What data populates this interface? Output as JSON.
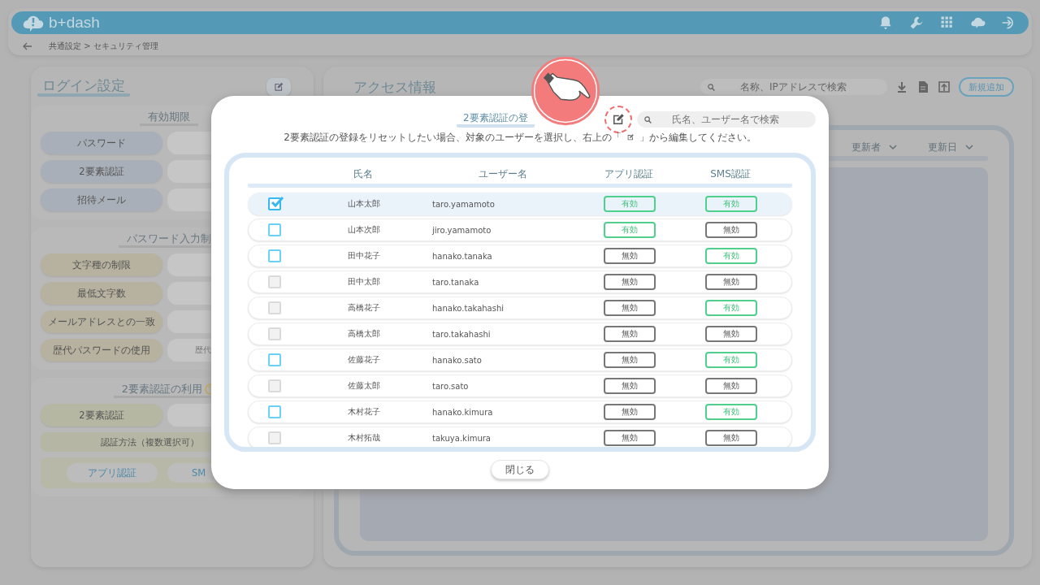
{
  "header": {
    "logo": "b+dash"
  },
  "breadcrumb": {
    "path": "共通設定 > セキュリティ管理"
  },
  "login_settings": {
    "title": "ログイン設定",
    "sections": [
      {
        "title": "有効期限",
        "color": "#a9afb8",
        "rows": [
          {
            "label": "パスワード",
            "value": ""
          },
          {
            "label": "2要素認証",
            "value": ""
          },
          {
            "label": "招待メール",
            "value": ""
          }
        ]
      },
      {
        "title": "パスワード入力制",
        "color": "#b7b29f",
        "rows": [
          {
            "label": "文字種の制限",
            "value": ""
          },
          {
            "label": "最低文字数",
            "value": ""
          },
          {
            "label": "メールアドレスとの一致",
            "value": ""
          },
          {
            "label": "歴代パスワードの使用",
            "value": "歴代"
          }
        ]
      },
      {
        "title": "2要素認証の利用",
        "color": "#b6b7a2",
        "help": true,
        "rows": [
          {
            "label": "2要素認証",
            "value": ""
          }
        ],
        "method_label": "認証方法（複数選択可）",
        "methods": [
          "アプリ認証",
          "SM"
        ]
      }
    ]
  },
  "access_info": {
    "title": "アクセス情報",
    "search": {
      "placeholder": "名称、IPアドレスで検索"
    },
    "add_button": "新規追加",
    "columns": [
      "更新者",
      "更新日"
    ]
  },
  "modal": {
    "title": "2要素認証の登",
    "search": {
      "placeholder": "氏名、ユーザー名で検索"
    },
    "description_before": "2要素認証の登録をリセットしたい場合、対象のユーザーを選択し、右上の「",
    "description_after": "」から編集してください。",
    "columns": [
      "氏名",
      "ユーザー名",
      "アプリ認証",
      "SMS認証"
    ],
    "rows": [
      {
        "selected": true,
        "checked": true,
        "disabled": false,
        "name": "山本太郎",
        "user": "taro.yamamoto",
        "app": {
          "label": "有効",
          "active": true
        },
        "sms": {
          "label": "有効",
          "active": true
        }
      },
      {
        "selected": false,
        "checked": false,
        "disabled": false,
        "name": "山本次郎",
        "user": "jiro.yamamoto",
        "app": {
          "label": "有効",
          "active": true
        },
        "sms": {
          "label": "無効",
          "active": false
        }
      },
      {
        "selected": false,
        "checked": false,
        "disabled": false,
        "name": "田中花子",
        "user": "hanako.tanaka",
        "app": {
          "label": "無効",
          "active": false
        },
        "sms": {
          "label": "有効",
          "active": true
        }
      },
      {
        "selected": false,
        "checked": false,
        "disabled": true,
        "name": "田中太郎",
        "user": "taro.tanaka",
        "app": {
          "label": "無効",
          "active": false
        },
        "sms": {
          "label": "無効",
          "active": false
        }
      },
      {
        "selected": false,
        "checked": false,
        "disabled": true,
        "name": "高橋花子",
        "user": "hanako.takahashi",
        "app": {
          "label": "無効",
          "active": false
        },
        "sms": {
          "label": "有効",
          "active": true
        }
      },
      {
        "selected": false,
        "checked": false,
        "disabled": true,
        "name": "高橋太郎",
        "user": "taro.takahashi",
        "app": {
          "label": "無効",
          "active": false
        },
        "sms": {
          "label": "無効",
          "active": false
        }
      },
      {
        "selected": false,
        "checked": false,
        "disabled": false,
        "name": "佐藤花子",
        "user": "hanako.sato",
        "app": {
          "label": "無効",
          "active": false
        },
        "sms": {
          "label": "有効",
          "active": true
        }
      },
      {
        "selected": false,
        "checked": false,
        "disabled": true,
        "name": "佐藤太郎",
        "user": "taro.sato",
        "app": {
          "label": "無効",
          "active": false
        },
        "sms": {
          "label": "無効",
          "active": false
        }
      },
      {
        "selected": false,
        "checked": false,
        "disabled": false,
        "name": "木村花子",
        "user": "hanako.kimura",
        "app": {
          "label": "無効",
          "active": false
        },
        "sms": {
          "label": "有効",
          "active": true
        }
      },
      {
        "selected": false,
        "checked": false,
        "disabled": true,
        "name": "木村拓哉",
        "user": "takuya.kimura",
        "app": {
          "label": "無効",
          "active": false
        },
        "sms": {
          "label": "無効",
          "active": false
        }
      }
    ],
    "close_button": "閉じる"
  }
}
